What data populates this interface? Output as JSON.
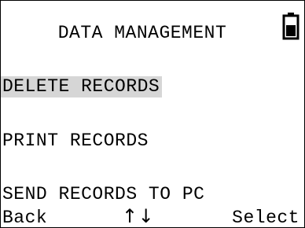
{
  "screen": {
    "title": "DATA MANAGEMENT",
    "battery_icon": "battery-icon"
  },
  "menu": {
    "items": [
      {
        "label": "DELETE RECORDS",
        "selected": true
      },
      {
        "label": "PRINT RECORDS",
        "selected": false
      },
      {
        "label": "SEND RECORDS TO PC",
        "selected": false
      }
    ]
  },
  "softkeys": {
    "left": "Back",
    "middle": "↑↓",
    "right": "Select"
  },
  "colors": {
    "selection_highlight": "#d6d6d6",
    "text": "#000000",
    "background": "#ffffff"
  }
}
